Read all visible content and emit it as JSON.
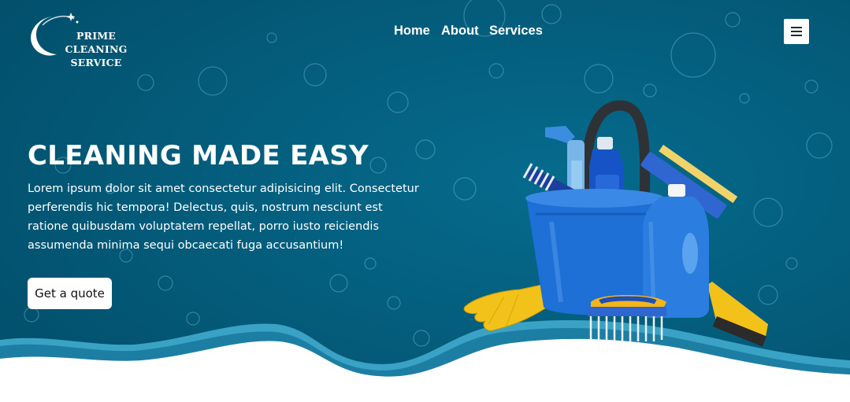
{
  "logo": {
    "line1": "PRIME CLEANING",
    "line2": "SERVICE"
  },
  "nav": {
    "items": [
      "Home",
      "About",
      "Services"
    ]
  },
  "hero": {
    "title": "CLEANING MADE EASY",
    "description": "Lorem ipsum dolor sit amet consectetur adipisicing elit. Consectetur perferendis hic tempora! Delectus, quis, nostrum nesciunt est ratione quibusdam voluptatem repellat, porro iusto reiciendis assumenda minima sequi obcaecati fuga accusantium!",
    "cta_label": "Get a quote"
  },
  "colors": {
    "background": "#035a78",
    "wave_light": "#3aa2c5",
    "wave_mid": "#1d7ea3",
    "bucket_blue": "#1e6fd6",
    "glove_yellow": "#f2c21a",
    "white": "#ffffff"
  },
  "icons": {
    "menu": "hamburger-menu-icon",
    "logo_mark": "crescent-sparkle-logo-icon"
  }
}
